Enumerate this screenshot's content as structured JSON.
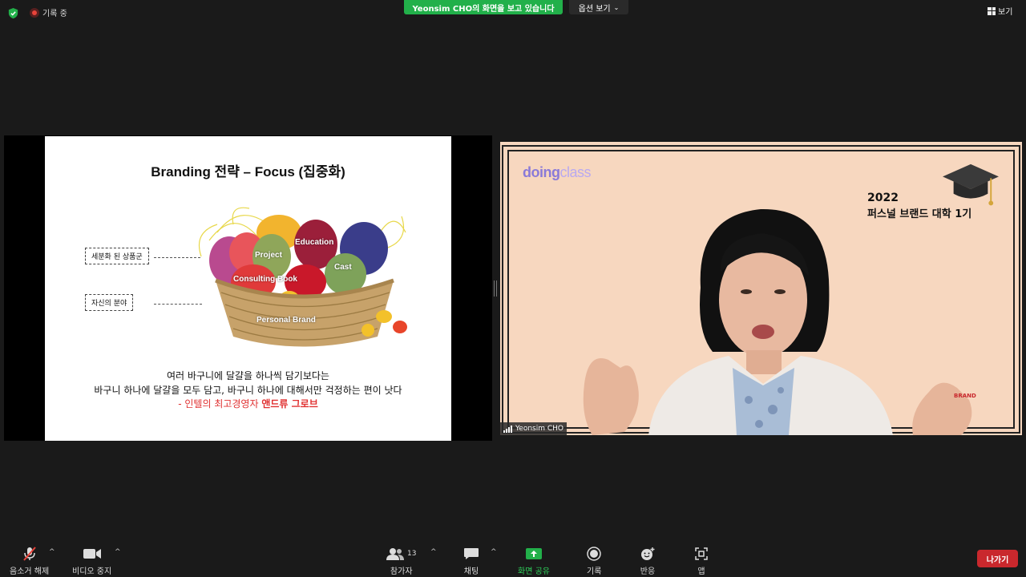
{
  "topbar": {
    "recording_label": "기록 중",
    "share_banner": "Yeonsim CHO의 화면을 보고 있습니다",
    "options_label": "옵션 보기",
    "view_label": "보기"
  },
  "slide": {
    "title": "Branding 전략 – Focus (집중화)",
    "egg_labels": {
      "project": "Project",
      "education": "Education",
      "cast": "Cast",
      "consulting_book": "Consulting Book",
      "personal_brand": "Personal Brand"
    },
    "side_labels": {
      "segmented": "세분화 된 상품군",
      "own_field": "자신의 분야"
    },
    "quote_line1": "여러 바구니에 달걀을 하나씩 담기보다는",
    "quote_line2": "바구니 하나에 달걀을 모두 담고, 바구니 하나에 대해서만 걱정하는 편이 낫다",
    "quote_attr_prefix": "- 인텔의 최고경영자 ",
    "quote_attr_name": "앤드류 그로브"
  },
  "video": {
    "logo_main": "doing",
    "logo_sub": "class",
    "year": "2022",
    "program": "퍼스널 브랜드 대학 1기",
    "brand_mark": "BRAND",
    "participant_name": "Yeonsim CHO"
  },
  "toolbar": {
    "unmute_label": "음소거 해제",
    "video_stop_label": "비디오 중지",
    "participants_label": "참가자",
    "participants_count": "13",
    "chat_label": "채팅",
    "share_label": "화면 공유",
    "record_label": "기록",
    "reactions_label": "반응",
    "apps_label": "앱",
    "leave_label": "나가기"
  },
  "colors": {
    "share_green": "#22b04a",
    "leave_red": "#c9282d",
    "background": "#1a1a1a",
    "video_bg": "#f7d7bf"
  }
}
